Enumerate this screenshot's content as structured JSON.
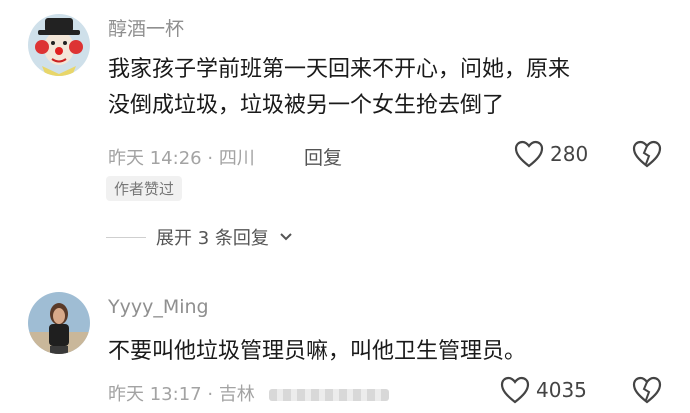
{
  "comments": [
    {
      "username": "醇酒一杯",
      "text_line1": "我家孩子学前班第一天回来不开心，问她，原来",
      "text_line2": "没倒成垃圾，垃圾被另一个女生抢去倒了",
      "time": "昨天 14:26",
      "location": "四川",
      "reply_label": "回复",
      "likes": "280",
      "author_badge": "作者赞过",
      "expand_label": "展开 3 条回复"
    },
    {
      "username": "Yyyy_Ming",
      "text_line1": "不要叫他垃圾管理员嘛，叫他卫生管理员。",
      "time": "昨天 13:17",
      "location": "吉林",
      "likes": "4035"
    }
  ],
  "colors": {
    "text": "#1a1a1a",
    "meta": "#a3a3a3",
    "icon": "#444444"
  }
}
